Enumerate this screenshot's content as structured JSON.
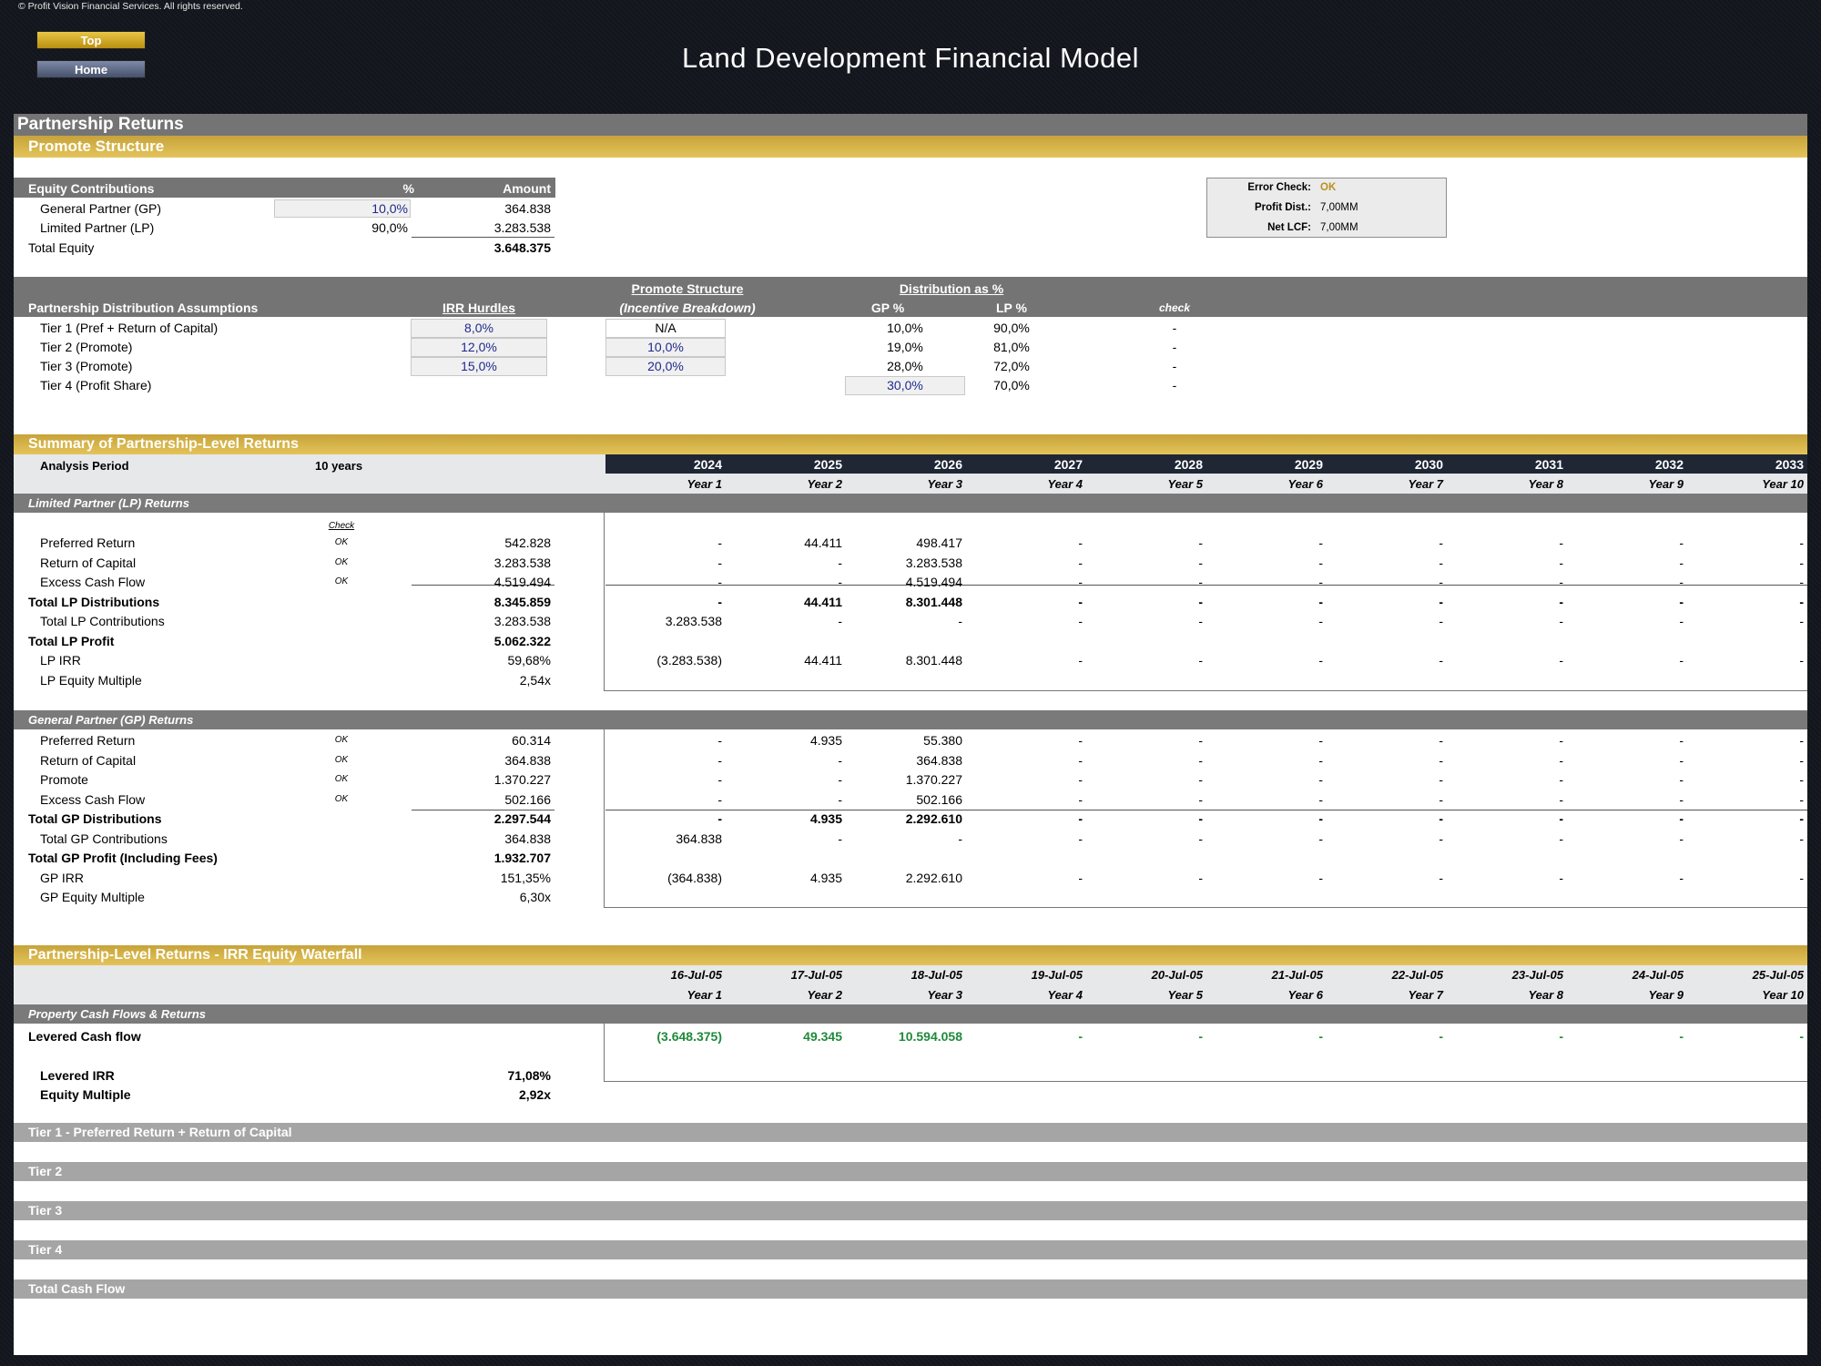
{
  "header": {
    "copyright": "© Profit Vision Financial Services. All rights reserved.",
    "top_button": "Top",
    "home_button": "Home",
    "title": "Land Development Financial Model"
  },
  "section": {
    "title": "Partnership Returns",
    "promote_title": "Promote Structure"
  },
  "equity": {
    "header_label": "Equity Contributions",
    "header_pct": "%",
    "header_amount": "Amount",
    "rows": [
      {
        "label": "General Partner (GP)",
        "pct": "10,0%",
        "amount": "364.838"
      },
      {
        "label": "Limited Partner (LP)",
        "pct": "90,0%",
        "amount": "3.283.538"
      }
    ],
    "total_label": "Total Equity",
    "total_amount": "3.648.375"
  },
  "checks": {
    "error_label": "Error Check:",
    "error_value": "OK",
    "profit_label": "Profit Dist.:",
    "profit_value": "7,00MM",
    "netlcf_label": "Net LCF:",
    "netlcf_value": "7,00MM"
  },
  "distribution": {
    "title": "Partnership Distribution Assumptions",
    "irr_header": "IRR Hurdles",
    "promote_header": "Promote Structure",
    "promote_sub": "(Incentive Breakdown)",
    "dist_header": "Distribution as %",
    "gp_header": "GP %",
    "lp_header": "LP %",
    "check_header": "check",
    "tiers": [
      {
        "label": "Tier 1 (Pref + Return of Capital)",
        "irr": "8,0%",
        "promote": "N/A",
        "gp": "10,0%",
        "lp": "90,0%",
        "check": "-"
      },
      {
        "label": "Tier 2 (Promote)",
        "irr": "12,0%",
        "promote": "10,0%",
        "gp": "19,0%",
        "lp": "81,0%",
        "check": "-"
      },
      {
        "label": "Tier 3 (Promote)",
        "irr": "15,0%",
        "promote": "20,0%",
        "gp": "28,0%",
        "lp": "72,0%",
        "check": "-"
      },
      {
        "label": "Tier 4 (Profit Share)",
        "irr": "",
        "promote": "",
        "gp": "30,0%",
        "lp": "70,0%",
        "check": "-"
      }
    ]
  },
  "summary": {
    "title": "Summary of Partnership-Level Returns",
    "analysis_label": "Analysis Period",
    "analysis_value": "10 years",
    "years": [
      "2024",
      "2025",
      "2026",
      "2027",
      "2028",
      "2029",
      "2030",
      "2031",
      "2032",
      "2033"
    ],
    "year_labels": [
      "Year 1",
      "Year 2",
      "Year 3",
      "Year 4",
      "Year 5",
      "Year 6",
      "Year 7",
      "Year 8",
      "Year 9",
      "Year 10"
    ],
    "check_header": "Check",
    "lp": {
      "title": "Limited Partner (LP) Returns",
      "rows": [
        {
          "label": "Preferred Return",
          "check": "OK",
          "total": "542.828",
          "vals": [
            "-",
            "44.411",
            "498.417",
            "-",
            "-",
            "-",
            "-",
            "-",
            "-",
            "-"
          ]
        },
        {
          "label": "Return of Capital",
          "check": "OK",
          "total": "3.283.538",
          "vals": [
            "-",
            "-",
            "3.283.538",
            "-",
            "-",
            "-",
            "-",
            "-",
            "-",
            "-"
          ]
        },
        {
          "label": "Excess Cash Flow",
          "check": "OK",
          "total": "4.519.494",
          "vals": [
            "-",
            "-",
            "4.519.494",
            "-",
            "-",
            "-",
            "-",
            "-",
            "-",
            "-"
          ]
        },
        {
          "label": "Total LP Distributions",
          "bold": true,
          "check": "",
          "total": "8.345.859",
          "vals": [
            "-",
            "44.411",
            "8.301.448",
            "-",
            "-",
            "-",
            "-",
            "-",
            "-",
            "-"
          ]
        },
        {
          "label": "Total LP Contributions",
          "check": "",
          "total": "3.283.538",
          "vals": [
            "3.283.538",
            "-",
            "-",
            "-",
            "-",
            "-",
            "-",
            "-",
            "-",
            "-"
          ],
          "shift": true
        },
        {
          "label": "Total LP Profit",
          "bold": true,
          "check": "",
          "total": "5.062.322",
          "vals": []
        },
        {
          "label": "LP IRR",
          "check": "",
          "total": "59,68%",
          "vals": [
            "(3.283.538)",
            "44.411",
            "8.301.448",
            "-",
            "-",
            "-",
            "-",
            "-",
            "-",
            "-"
          ],
          "shift": true
        },
        {
          "label": "LP Equity Multiple",
          "check": "",
          "total": "2,54x",
          "vals": []
        }
      ]
    },
    "gp": {
      "title": "General Partner (GP) Returns",
      "rows": [
        {
          "label": "Preferred Return",
          "check": "OK",
          "total": "60.314",
          "vals": [
            "-",
            "4.935",
            "55.380",
            "-",
            "-",
            "-",
            "-",
            "-",
            "-",
            "-"
          ]
        },
        {
          "label": "Return of Capital",
          "check": "OK",
          "total": "364.838",
          "vals": [
            "-",
            "-",
            "364.838",
            "-",
            "-",
            "-",
            "-",
            "-",
            "-",
            "-"
          ]
        },
        {
          "label": "Promote",
          "check": "OK",
          "total": "1.370.227",
          "vals": [
            "-",
            "-",
            "1.370.227",
            "-",
            "-",
            "-",
            "-",
            "-",
            "-",
            "-"
          ]
        },
        {
          "label": "Excess Cash Flow",
          "check": "OK",
          "total": "502.166",
          "vals": [
            "-",
            "-",
            "502.166",
            "-",
            "-",
            "-",
            "-",
            "-",
            "-",
            "-"
          ]
        },
        {
          "label": "Total GP Distributions",
          "bold": true,
          "check": "",
          "total": "2.297.544",
          "vals": [
            "-",
            "4.935",
            "2.292.610",
            "-",
            "-",
            "-",
            "-",
            "-",
            "-",
            "-"
          ]
        },
        {
          "label": "Total GP Contributions",
          "check": "",
          "total": "364.838",
          "vals": [
            "364.838",
            "-",
            "-",
            "-",
            "-",
            "-",
            "-",
            "-",
            "-",
            "-"
          ],
          "shift": true
        },
        {
          "label": "Total GP Profit (Including Fees)",
          "bold": true,
          "check": "",
          "total": "1.932.707",
          "vals": []
        },
        {
          "label": "GP IRR",
          "check": "",
          "total": "151,35%",
          "vals": [
            "(364.838)",
            "4.935",
            "2.292.610",
            "-",
            "-",
            "-",
            "-",
            "-",
            "-",
            "-"
          ],
          "shift": true
        },
        {
          "label": "GP Equity Multiple",
          "check": "",
          "total": "6,30x",
          "vals": []
        }
      ]
    }
  },
  "waterfall": {
    "title": "Partnership-Level Returns - IRR Equity Waterfall",
    "dates": [
      "16-Jul-05",
      "17-Jul-05",
      "18-Jul-05",
      "19-Jul-05",
      "20-Jul-05",
      "21-Jul-05",
      "22-Jul-05",
      "23-Jul-05",
      "24-Jul-05",
      "25-Jul-05"
    ],
    "year_labels": [
      "Year 1",
      "Year 2",
      "Year 3",
      "Year 4",
      "Year 5",
      "Year 6",
      "Year 7",
      "Year 8",
      "Year 9",
      "Year 10"
    ],
    "property_title": "Property Cash Flows & Returns",
    "levered_label": "Levered Cash flow",
    "levered_vals": [
      "(3.648.375)",
      "49.345",
      "10.594.058",
      "-",
      "-",
      "-",
      "-",
      "-",
      "-",
      "-"
    ],
    "irr_label": "Levered IRR",
    "irr_value": "71,08%",
    "multiple_label": "Equity Multiple",
    "multiple_value": "2,92x",
    "tiers": [
      "Tier 1 - Preferred Return + Return of Capital",
      "Tier 2",
      "Tier 3",
      "Tier 4",
      "Total Cash Flow"
    ]
  },
  "colors": {
    "gold": "#d4b24a",
    "dark_grey": "#747474",
    "navy": "#1f2735",
    "input_blue": "#1f2a8c",
    "positive_green": "#1f8a3a"
  }
}
